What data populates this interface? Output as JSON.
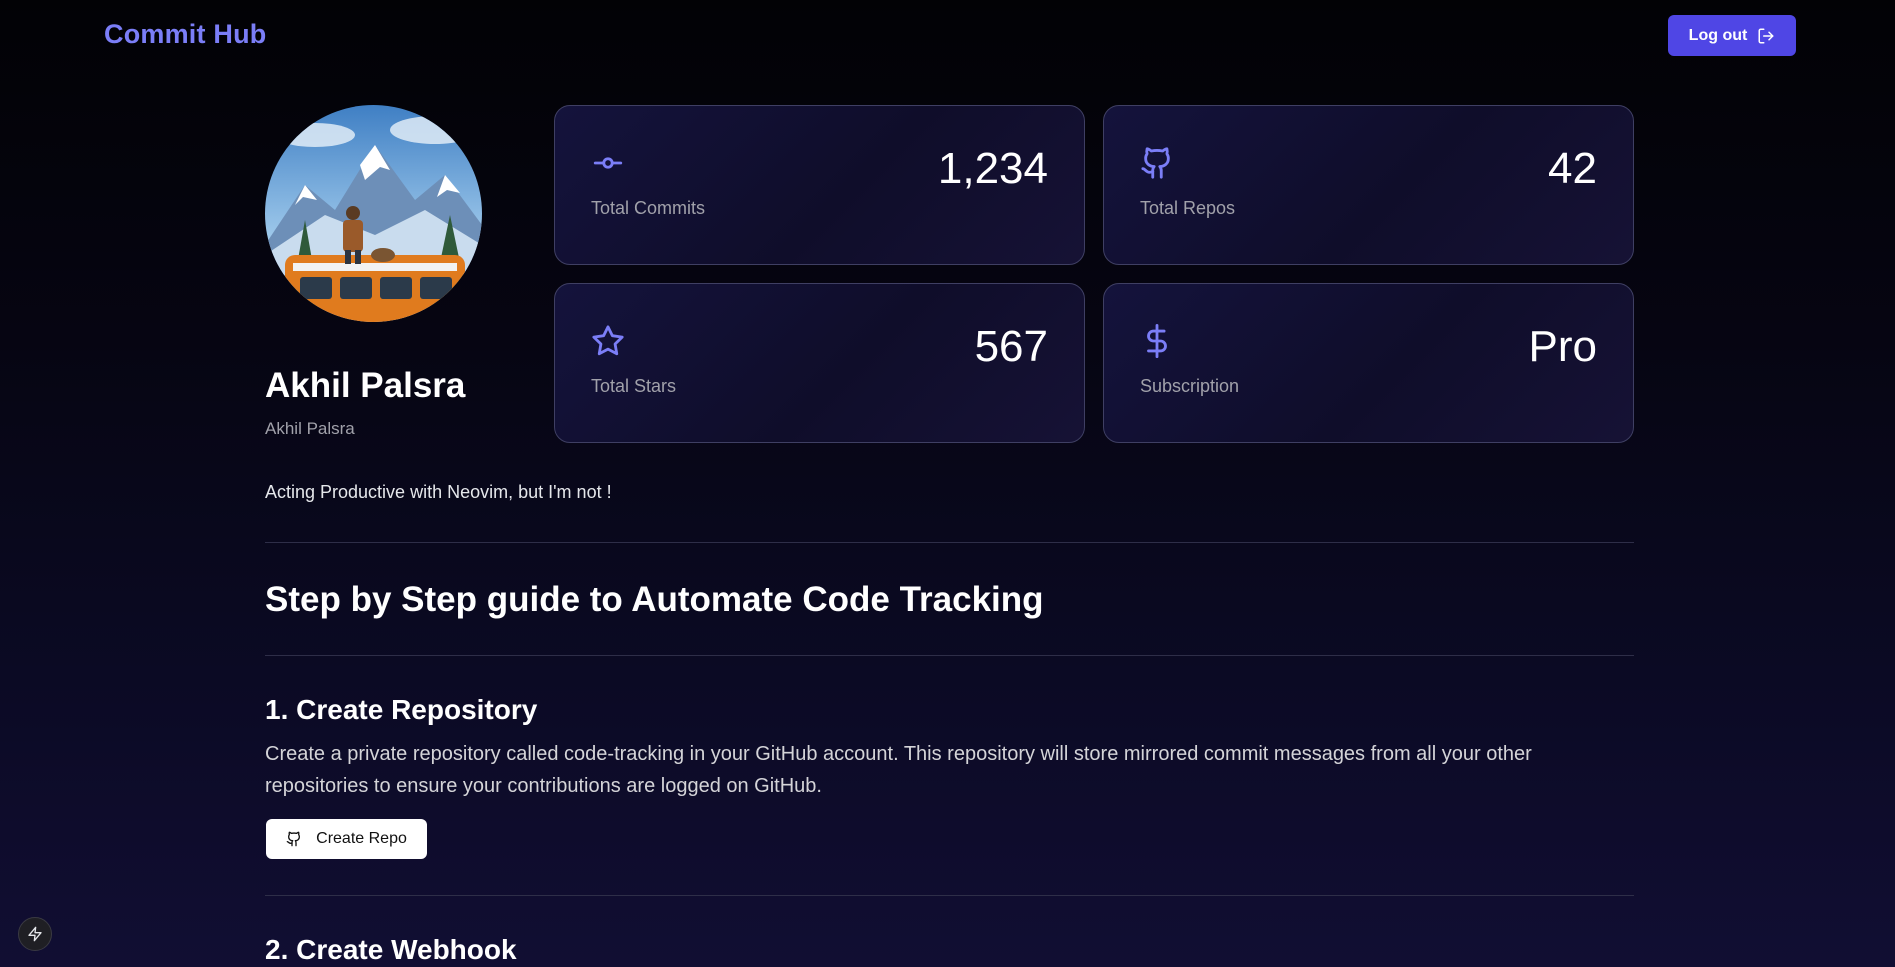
{
  "header": {
    "brand": "Commit Hub",
    "logout_label": "Log out"
  },
  "profile": {
    "name": "Akhil Palsra",
    "username": "Akhil Palsra",
    "bio": "Acting Productive with Neovim, but I'm not !"
  },
  "stats": [
    {
      "label": "Total Commits",
      "value": "1,234",
      "icon": "git-commit-icon"
    },
    {
      "label": "Total Repos",
      "value": "42",
      "icon": "github-icon"
    },
    {
      "label": "Total Stars",
      "value": "567",
      "icon": "star-icon"
    },
    {
      "label": "Subscription",
      "value": "Pro",
      "icon": "dollar-icon"
    }
  ],
  "guide": {
    "title": "Step by Step guide to Automate Code Tracking",
    "steps": [
      {
        "title": "1. Create Repository",
        "description": "Create a private repository called code-tracking in your GitHub account. This repository will store mirrored commit messages from all your other repositories to ensure your contributions are logged on GitHub.",
        "button_label": "Create Repo"
      },
      {
        "title": "2. Create Webhook"
      }
    ]
  },
  "colors": {
    "accent": "#7b7ef7",
    "button": "#4f46e5",
    "icon": "#7b7ef7"
  }
}
